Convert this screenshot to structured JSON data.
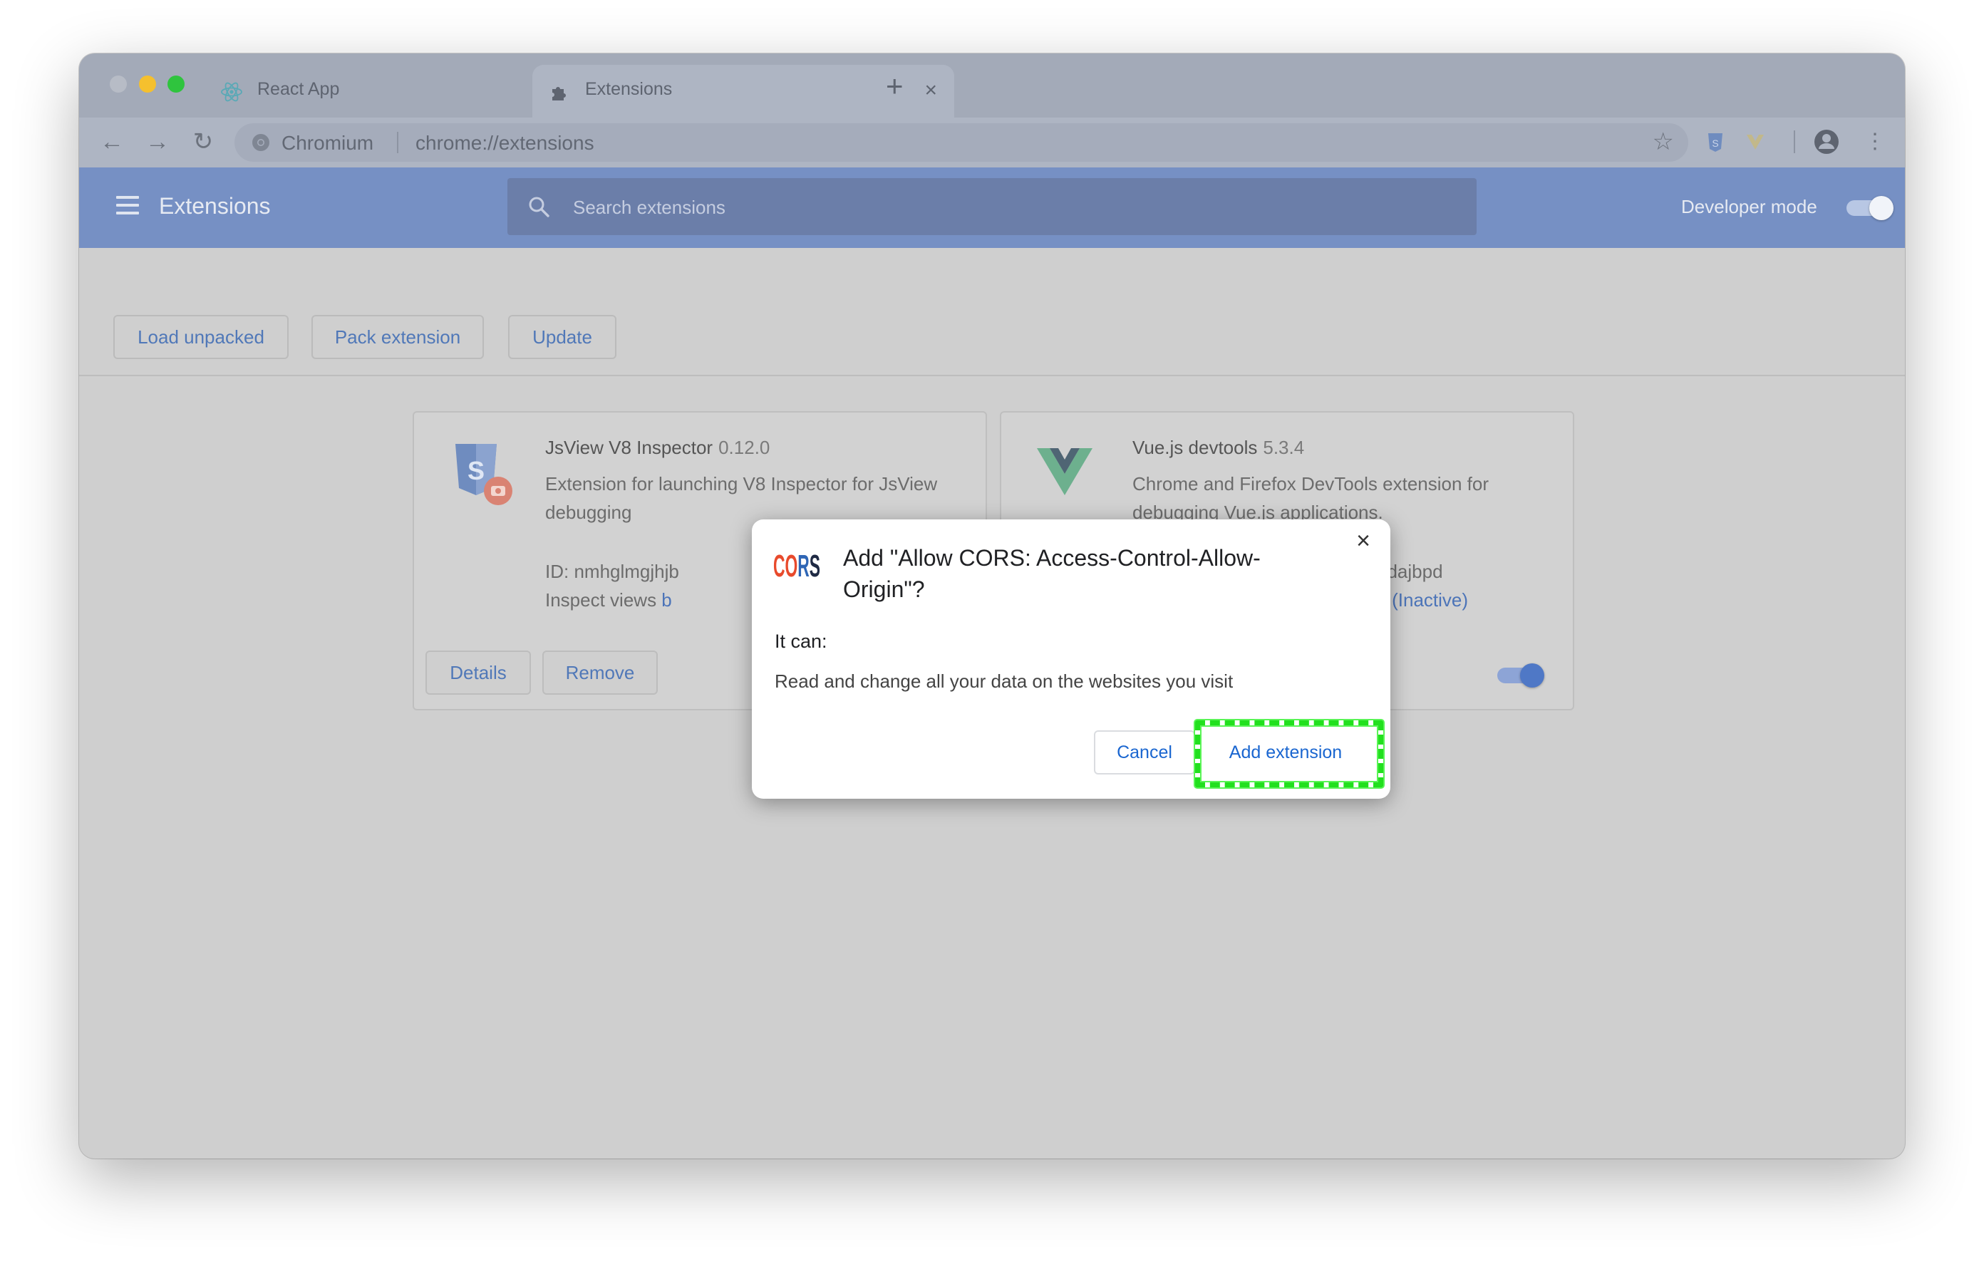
{
  "tabs": [
    {
      "title": "React App",
      "icon": "react-icon"
    },
    {
      "title": "Extensions",
      "icon": "puzzle-icon"
    }
  ],
  "toolbar": {
    "scheme": "Chromium",
    "url": "chrome://extensions"
  },
  "header": {
    "title": "Extensions",
    "search_placeholder": "Search extensions",
    "developer_mode_label": "Developer mode",
    "developer_mode_on": true
  },
  "actions": {
    "load_unpacked": "Load unpacked",
    "pack_extension": "Pack extension",
    "update": "Update"
  },
  "cards": [
    {
      "name": "JsView V8 Inspector",
      "version": "0.12.0",
      "description": "Extension for launching V8 Inspector for JsView debugging",
      "id_label": "ID: nmhglmgjhjb",
      "views_label": "Inspect views ",
      "views_link": "b",
      "details": "Details",
      "remove": "Remove"
    },
    {
      "name": "Vue.js devtools",
      "version": "5.3.4",
      "description": "Chrome and Firefox DevTools extension for debugging Vue.js applications.",
      "id_tail": "nnnanhbledajbpd",
      "views_tail": "ound page (Inactive)",
      "enabled": true
    }
  ],
  "dialog": {
    "title": "Add \"Allow CORS: Access-Control-Allow-Origin\"?",
    "logo_text": "CORS",
    "it_can": "It can:",
    "permission": "Read and change all your data on the websites you visit",
    "cancel": "Cancel",
    "add": "Add extension",
    "close": "×"
  },
  "colors": {
    "highlight": "#22e01e",
    "dialog_button_text": "#1a66d0",
    "header": "#7690c4"
  }
}
